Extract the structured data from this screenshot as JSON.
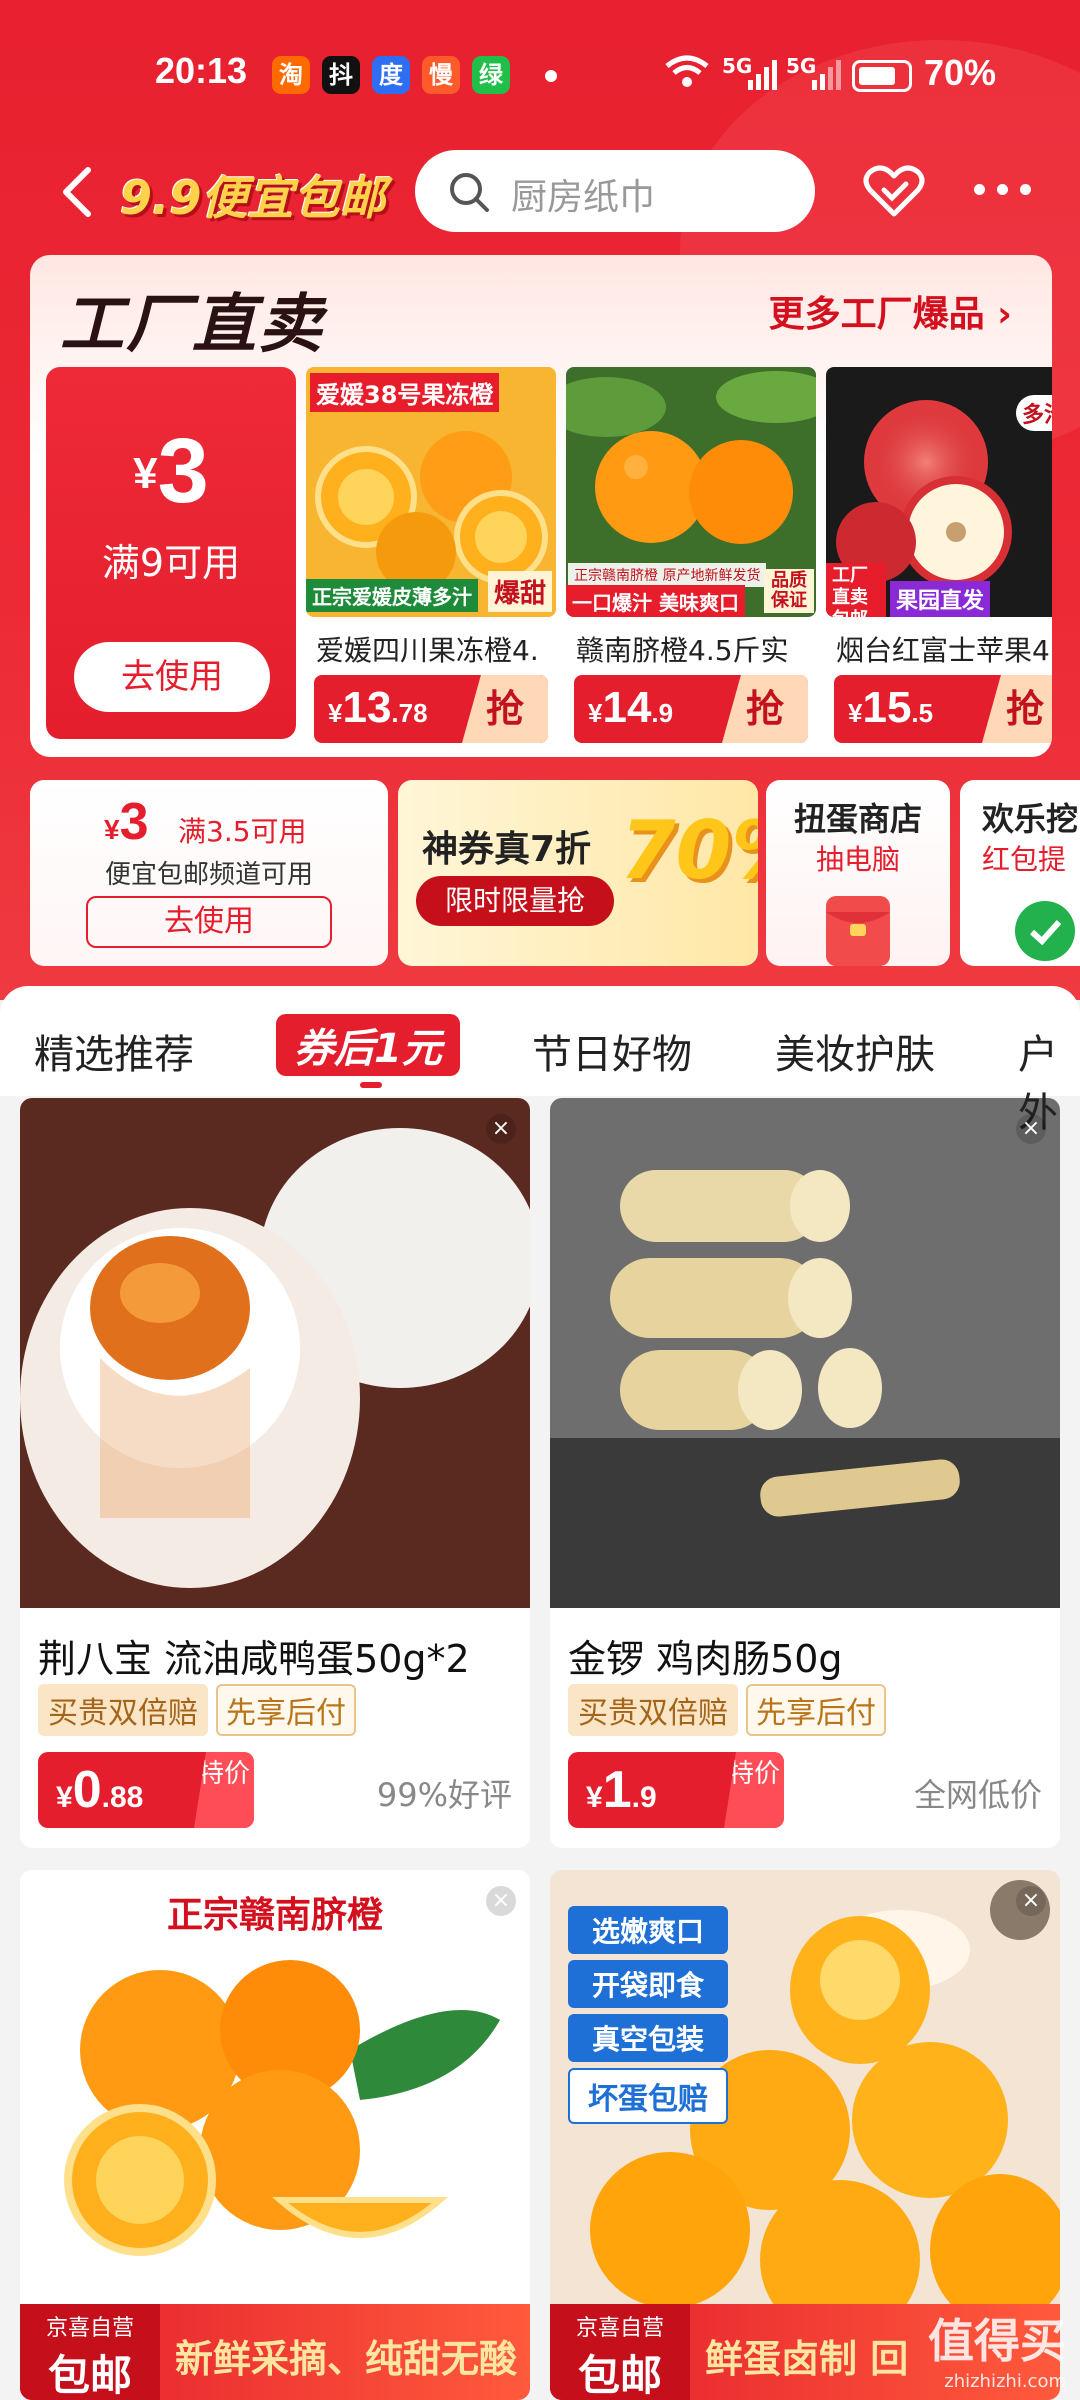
{
  "status": {
    "time": "20:13",
    "apps": [
      "淘",
      "抖",
      "度",
      "慢",
      "绿"
    ],
    "net1": "5G",
    "net2": "5G",
    "battery": "70%"
  },
  "nav": {
    "brand": "9.9便宜包邮",
    "search_placeholder": "厨房纸巾"
  },
  "factory": {
    "title": "工厂直卖",
    "more": "更多工厂爆品",
    "coupon": {
      "currency": "¥",
      "amount": "3",
      "condition": "满9可用",
      "use": "去使用"
    },
    "products": [
      {
        "name": "爱媛四川果冻橙4.",
        "yen": "¥",
        "int": "13",
        "dec": ".78",
        "grab": "抢",
        "tag_top": "爱媛38号果冻橙",
        "tag_bottom": "正宗爱媛皮薄多汁",
        "tag_right": "爆甜"
      },
      {
        "name": "赣南脐橙4.5斤实",
        "yen": "¥",
        "int": "14",
        "dec": ".9",
        "grab": "抢",
        "tag_top": "正宗赣南脐橙  原产地新鲜发货",
        "tag_bottom": "一口爆汁 美味爽口",
        "tag_right": "品质保证"
      },
      {
        "name": "烟台红富士苹果4",
        "yen": "¥",
        "int": "15",
        "dec": ".5",
        "grab": "抢",
        "tag_top": "多汁",
        "tag_bottom": "果园直发",
        "tag_left": "工厂直卖包邮"
      }
    ]
  },
  "row2": {
    "coupon": {
      "currency": "¥",
      "amount": "3",
      "condition": "满3.5可用",
      "sub": "便宜包邮频道可用",
      "use": "去使用"
    },
    "promo": {
      "title": "神券真7折",
      "sub": "限时限量抢",
      "big": "70%"
    },
    "gacha": {
      "title": "扭蛋商店",
      "sub": "抽电脑"
    },
    "fun": {
      "title": "欢乐挖",
      "sub": "红包提"
    }
  },
  "tabs": {
    "items": [
      "精选推荐",
      "券后1元",
      "节日好物",
      "美妆护肤",
      "户外"
    ],
    "active": 1
  },
  "products": [
    {
      "title": "荆八宝 流油咸鸭蛋50g*2",
      "badge1": "买贵双倍赔",
      "badge2": "先享后付",
      "yen": "¥",
      "int": "0",
      "dec": ".88",
      "special": "特价",
      "note": "99%好评"
    },
    {
      "title": "金锣 鸡肉肠50g",
      "badge1": "买贵双倍赔",
      "badge2": "先享后付",
      "yen": "¥",
      "int": "1",
      "dec": ".9",
      "special": "特价",
      "note": "全网低价"
    },
    {
      "img_text": "正宗赣南脐橙",
      "jd": "京喜自营",
      "ship": "包邮",
      "banner": "新鲜采摘、纯甜无酸"
    },
    {
      "tags": [
        "选嫩爽口",
        "开袋即食",
        "真空包装",
        "坏蛋包赔"
      ],
      "jd": "京喜自营",
      "ship": "包邮",
      "banner": "鲜蛋卤制 回"
    }
  ],
  "watermark": {
    "name": "值得买",
    "url": "zhizhizhi.com"
  }
}
